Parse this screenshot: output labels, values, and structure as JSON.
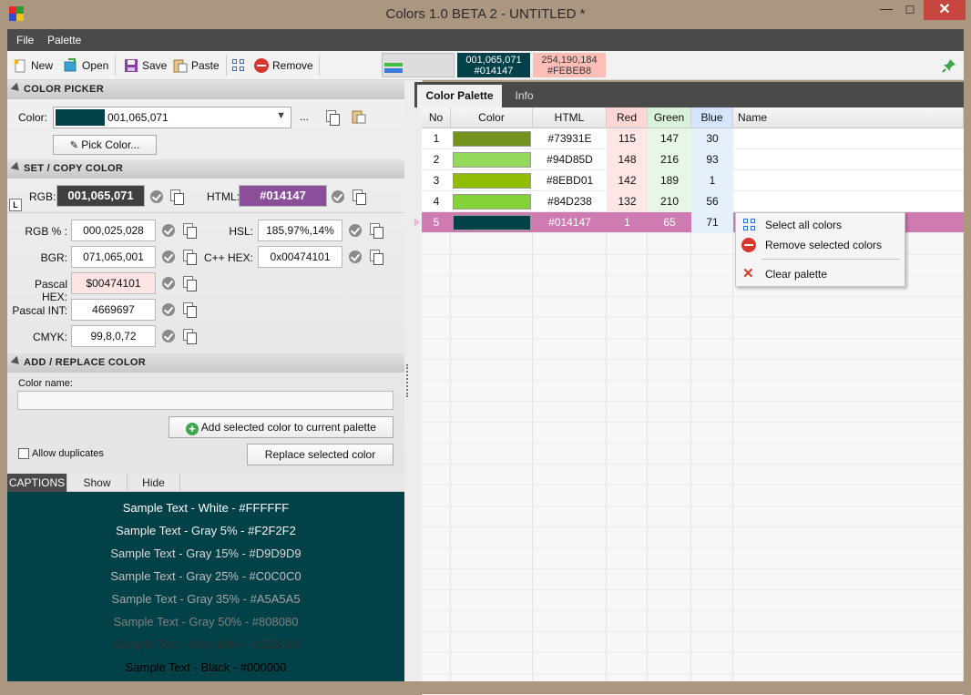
{
  "window": {
    "title": "Colors 1.0 BETA 2 - UNTITLED *",
    "minimize": "—",
    "maximize": "☐",
    "close": "✕"
  },
  "menu": {
    "file": "File",
    "palette": "Palette"
  },
  "toolbar": {
    "new": "New",
    "open": "Open",
    "save": "Save",
    "paste": "Paste",
    "remove": "Remove",
    "swatch_main_rgb": "001,065,071",
    "swatch_main_html": "#014147",
    "swatch_second_rgb": "254,190,184",
    "swatch_second_html": "#FEBEB8",
    "colors": {
      "main": "#014147",
      "second": "#FEBEB8"
    }
  },
  "color_picker": {
    "header": "COLOR  PICKER",
    "color_label": "Color:",
    "color_value": "001,065,071",
    "more": "...",
    "pick_button": "Pick Color..."
  },
  "set_copy": {
    "header": "SET / COPY  COLOR",
    "l_badge": "L",
    "rgb_label": "RGB:",
    "rgb_value": "001,065,071",
    "html_label": "HTML:",
    "html_value": "#014147",
    "rgbpct_label": "RGB % :",
    "rgbpct_value": "000,025,028",
    "hsl_label": "HSL:",
    "hsl_value": "185,97%,14%",
    "bgr_label": "BGR:",
    "bgr_value": "071,065,001",
    "cpphex_label": "C++ HEX:",
    "cpphex_value": "0x00474101",
    "pascalhex_label": "Pascal HEX:",
    "pascalhex_value": "$00474101",
    "pascalint_label": "Pascal INT:",
    "pascalint_value": "4669697",
    "cmyk_label": "CMYK:",
    "cmyk_value": "99,8,0,72"
  },
  "add_replace": {
    "header": "ADD / REPLACE  COLOR",
    "name_label": "Color name:",
    "name_value": "",
    "add_button": "Add selected color to current palette",
    "allow_duplicates": "Allow duplicates",
    "replace_button": "Replace selected color"
  },
  "captions": {
    "tab_captions": "CAPTIONS",
    "tab_show": "Show",
    "tab_hide": "Hide",
    "lines": [
      {
        "text": "Sample Text - White - #FFFFFF",
        "color": "#FFFFFF"
      },
      {
        "text": "Sample Text - Gray 5% - #F2F2F2",
        "color": "#F2F2F2"
      },
      {
        "text": "Sample Text - Gray 15% - #D9D9D9",
        "color": "#D9D9D9"
      },
      {
        "text": "Sample Text - Gray 25% - #C0C0C0",
        "color": "#C0C0C0"
      },
      {
        "text": "Sample Text - Gray 35% - #A5A5A5",
        "color": "#A5A5A5"
      },
      {
        "text": "Sample Text - Gray 50% - #808080",
        "color": "#808080"
      },
      {
        "text": "Sample Text - Gray 80% - #333333",
        "color": "#333333"
      },
      {
        "text": "Sample Text - Black - #000000",
        "color": "#000000"
      }
    ]
  },
  "tabs": {
    "palette": "Color Palette",
    "info": "Info"
  },
  "grid": {
    "headers": {
      "no": "No",
      "color": "Color",
      "html": "HTML",
      "red": "Red",
      "green": "Green",
      "blue": "Blue",
      "name": "Name"
    },
    "rows": [
      {
        "no": "1",
        "color": "#73931E",
        "html": "#73931E",
        "red": "115",
        "green": "147",
        "blue": "30"
      },
      {
        "no": "2",
        "color": "#94D85D",
        "html": "#94D85D",
        "red": "148",
        "green": "216",
        "blue": "93"
      },
      {
        "no": "3",
        "color": "#8EBD01",
        "html": "#8EBD01",
        "red": "142",
        "green": "189",
        "blue": "1"
      },
      {
        "no": "4",
        "color": "#84D238",
        "html": "#84D238",
        "red": "132",
        "green": "210",
        "blue": "56"
      },
      {
        "no": "5",
        "color": "#014147",
        "html": "#014147",
        "red": "1",
        "green": "65",
        "blue": "71"
      }
    ]
  },
  "context_menu": {
    "select_all": "Select all colors",
    "remove_selected": "Remove selected colors",
    "clear": "Clear palette"
  }
}
